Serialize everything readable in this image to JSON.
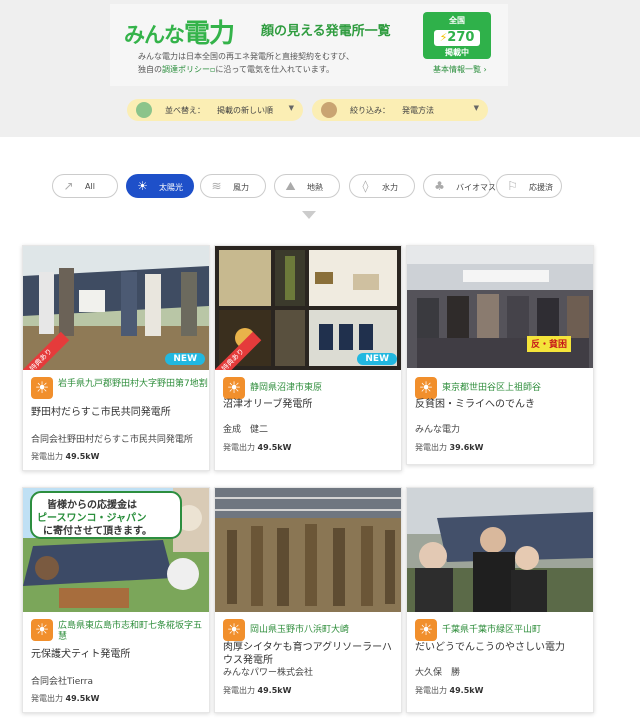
{
  "header": {
    "logo_a": "みんな",
    "logo_b": "電力",
    "tagline": "顔の見える発電所一覧",
    "desc_1": "みんな電力は日本全国の再エネ発電所と直接契約をむすび、",
    "desc_2a": "独自の",
    "desc_policy": "調達ポリシー",
    "desc_2b": "に沿って電気を仕入れています。",
    "count_label_top": "全国",
    "count_value": "270",
    "count_label_bottom": "掲載中",
    "basic_info_link": "基本情報一覧"
  },
  "controls": {
    "sort_label": "並べ替え：",
    "sort_value": "掲載の新しい順",
    "filter_label": "絞り込み：",
    "filter_value": "発電方法"
  },
  "tabs": [
    {
      "label": "All",
      "icon": "flame-icon",
      "active": false
    },
    {
      "label": "太陽光",
      "icon": "sun-icon",
      "active": true
    },
    {
      "label": "風力",
      "icon": "wind-icon",
      "active": false
    },
    {
      "label": "地熱",
      "icon": "mountain-icon",
      "active": false
    },
    {
      "label": "水力",
      "icon": "water-drop-icon",
      "active": false
    },
    {
      "label": "バイオマス",
      "icon": "tree-icon",
      "active": false
    },
    {
      "label": "応援済",
      "icon": "flag-icon",
      "active": false
    }
  ],
  "cards": [
    {
      "location": "岩手県九戸郡野田村大字野田第7地割",
      "name": "野田村だらすこ市民共同発電所",
      "owner": "合同会社野田村だらすこ市民共同発電所",
      "output_label": "発電出力",
      "output_value": "49.5kW",
      "badge_new": "NEW",
      "badge_toku": "特典あり"
    },
    {
      "location": "静岡県沼津市東原",
      "name": "沼津オリーブ発電所",
      "owner": "金成　健二",
      "output_label": "発電出力",
      "output_value": "49.5kW",
      "badge_new": "NEW",
      "badge_toku": "特典あり"
    },
    {
      "location": "東京都世田谷区上祖師谷",
      "name": "反貧困・ミライへのでんき",
      "owner": "みんな電力",
      "output_label": "発電出力",
      "output_value": "39.6kW"
    },
    {
      "location": "広島県東広島市志和町七条椛坂字五慧",
      "name": "元保護犬ティト発電所",
      "owner": "合同会社Tierra",
      "output_label": "発電出力",
      "output_value": "49.5kW"
    },
    {
      "location": "岡山県玉野市八浜町大崎",
      "name": "肉厚シイタケも育つアグリソーラーハウス発電所",
      "owner": "みんなパワー株式会社",
      "output_label": "発電出力",
      "output_value": "49.5kW"
    },
    {
      "location": "千葉県千葉市緑区平山町",
      "name": "だいどうでんこうのやさしい電力",
      "owner": "大久保　勝",
      "output_label": "発電出力",
      "output_value": "49.5kW"
    }
  ],
  "photo_texts": {
    "card4_sign_1": "皆様からの応援金は",
    "card4_sign_2": "ピースワンコ・ジャパン",
    "card4_sign_3": "に寄付させて頂きます。",
    "card3_banner": "反・貧困"
  }
}
